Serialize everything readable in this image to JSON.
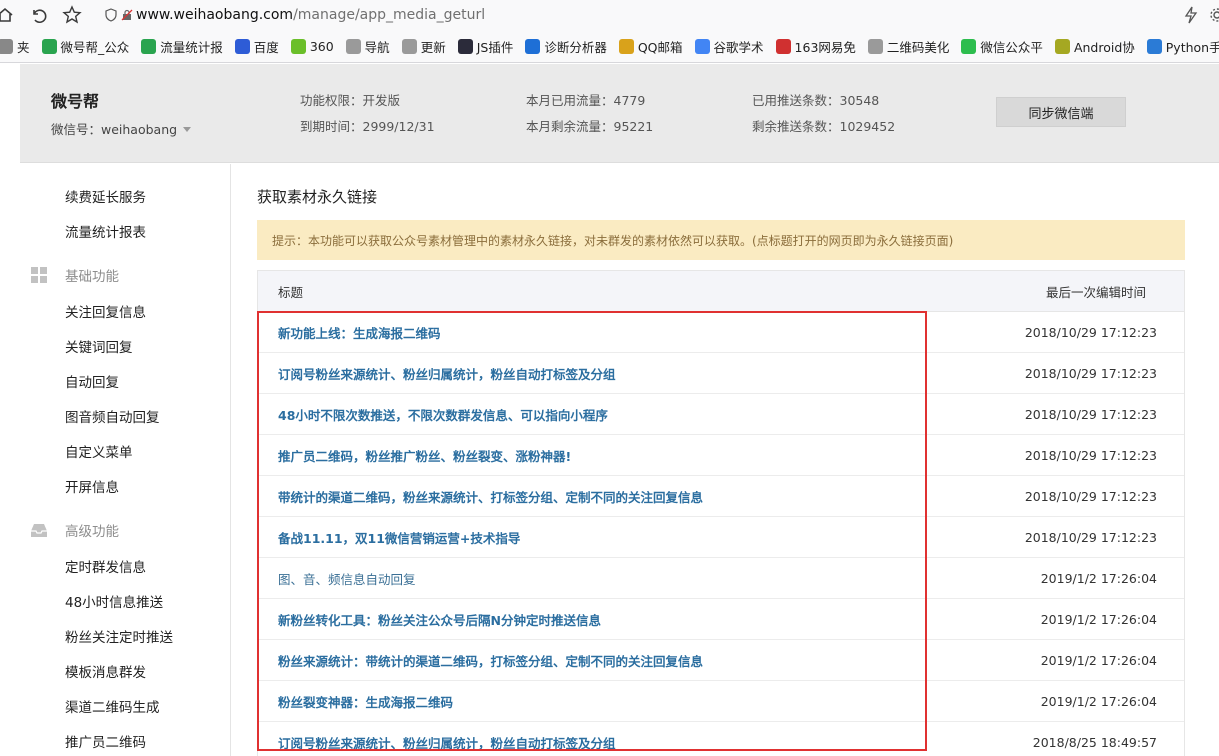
{
  "browser": {
    "url_host": "www.weihaobang.com",
    "url_path": "/manage/app_media_geturl",
    "bookmarks": [
      {
        "label": "夹",
        "icon": "folder-icon",
        "color": "#888888"
      },
      {
        "label": "微号帮_公众",
        "icon": "weihaobang-icon",
        "color": "#2aa44f"
      },
      {
        "label": "流量统计报",
        "icon": "weihaobang-icon",
        "color": "#2aa44f"
      },
      {
        "label": "百度",
        "icon": "baidu-paw-icon",
        "color": "#2e5cd6"
      },
      {
        "label": "360",
        "icon": "360-icon",
        "color": "#6bbf2a"
      },
      {
        "label": "导航",
        "icon": "page-icon",
        "color": "#9a9a9a"
      },
      {
        "label": "更新",
        "icon": "page-icon",
        "color": "#9a9a9a"
      },
      {
        "label": "JS插件",
        "icon": "js-icon",
        "color": "#2b2b3a"
      },
      {
        "label": "诊断分析器",
        "icon": "diagnose-icon",
        "color": "#1e6fd6"
      },
      {
        "label": "QQ邮箱",
        "icon": "chrome-icon",
        "color": "#d9a21b"
      },
      {
        "label": "谷歌学术",
        "icon": "google-icon",
        "color": "#4285f4"
      },
      {
        "label": "163网易免",
        "icon": "163-icon",
        "color": "#d03030"
      },
      {
        "label": "二维码美化",
        "icon": "page-icon",
        "color": "#9a9a9a"
      },
      {
        "label": "微信公众平",
        "icon": "wechat-icon",
        "color": "#2dbd4e"
      },
      {
        "label": "Android协",
        "icon": "android-icon",
        "color": "#a5a822"
      },
      {
        "label": "Python手册",
        "icon": "python-icon",
        "color": "#2b7bd6"
      },
      {
        "label": "",
        "icon": "book-icon",
        "color": "#2b2b3a"
      }
    ]
  },
  "header": {
    "account_name": "微号帮",
    "wechat_id": "微信号：weihaobang",
    "permission": "功能权限：开发版",
    "expire": "到期时间：2999/12/31",
    "month_used": "本月已用流量：4779",
    "month_left": "本月剩余流量：95221",
    "push_used": "已用推送条数：30548",
    "push_left": "剩余推送条数：1029452",
    "sync_button": "同步微信端"
  },
  "sidebar": {
    "top_items": [
      "续费延长服务",
      "流量统计报表"
    ],
    "group_basic": "基础功能",
    "basic_items": [
      "关注回复信息",
      "关键词回复",
      "自动回复",
      "图音频自动回复",
      "自定义菜单",
      "开屏信息"
    ],
    "group_advanced": "高级功能",
    "advanced_items": [
      "定时群发信息",
      "48小时信息推送",
      "粉丝关注定时推送",
      "模板消息群发",
      "渠道二维码生成",
      "推广员二维码"
    ]
  },
  "main": {
    "title": "获取素材永久链接",
    "tip": "提示：本功能可以获取公众号素材管理中的素材永久链接，对未群发的素材依然可以获取。(点标题打开的网页即为永久链接页面)",
    "col_title": "标题",
    "col_time": "最后一次编辑时间",
    "rows": [
      {
        "title": "新功能上线：生成海报二维码",
        "time": "2018/10/29 17:12:23"
      },
      {
        "title": "订阅号粉丝来源统计、粉丝归属统计，粉丝自动打标签及分组",
        "time": "2018/10/29 17:12:23"
      },
      {
        "title": "48小时不限次数推送，不限次数群发信息、可以指向小程序",
        "time": "2018/10/29 17:12:23"
      },
      {
        "title": "推广员二维码，粉丝推广粉丝、粉丝裂变、涨粉神器!",
        "time": "2018/10/29 17:12:23"
      },
      {
        "title": "带统计的渠道二维码，粉丝来源统计、打标签分组、定制不同的关注回复信息",
        "time": "2018/10/29 17:12:23"
      },
      {
        "title": "备战11.11，双11微信营销运营+技术指导",
        "time": "2018/10/29 17:12:23"
      },
      {
        "title": "图、音、频信息自动回复",
        "time": "2019/1/2 17:26:04"
      },
      {
        "title": "新粉丝转化工具：粉丝关注公众号后隔N分钟定时推送信息",
        "time": "2019/1/2 17:26:04"
      },
      {
        "title": "粉丝来源统计：带统计的渠道二维码，打标签分组、定制不同的关注回复信息",
        "time": "2019/1/2 17:26:04"
      },
      {
        "title": "粉丝裂变神器：生成海报二维码",
        "time": "2019/1/2 17:26:04"
      },
      {
        "title": "订阅号粉丝来源统计、粉丝归属统计，粉丝自动打标签及分组",
        "time": "2018/8/25 18:49:57"
      }
    ]
  },
  "colors": {
    "link": "#2b6ea0",
    "tip_bg": "#faebc2",
    "tip_text": "#8a6d3b",
    "highlight": "#e03131"
  }
}
